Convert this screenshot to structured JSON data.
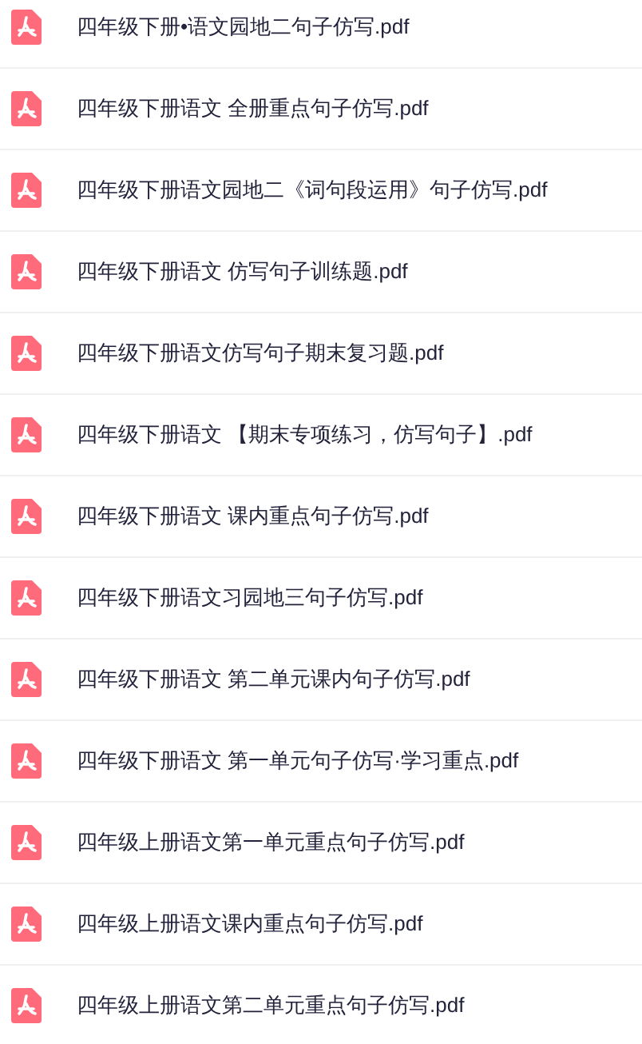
{
  "files": [
    {
      "name": "四年级下册•语文园地二句子仿写.pdf"
    },
    {
      "name": "四年级下册语文 全册重点句子仿写.pdf"
    },
    {
      "name": "四年级下册语文园地二《词句段运用》句子仿写.pdf"
    },
    {
      "name": "四年级下册语文 仿写句子训练题.pdf"
    },
    {
      "name": "四年级下册语文仿写句子期末复习题.pdf"
    },
    {
      "name": "四年级下册语文 【期末专项练习，仿写句子】.pdf"
    },
    {
      "name": "四年级下册语文 课内重点句子仿写.pdf"
    },
    {
      "name": "四年级下册语文习园地三句子仿写.pdf"
    },
    {
      "name": "四年级下册语文 第二单元课内句子仿写.pdf"
    },
    {
      "name": "四年级下册语文 第一单元句子仿写·学习重点.pdf"
    },
    {
      "name": "四年级上册语文第一单元重点句子仿写.pdf"
    },
    {
      "name": "四年级上册语文课内重点句子仿写.pdf"
    },
    {
      "name": "四年级上册语文第二单元重点句子仿写.pdf"
    }
  ]
}
